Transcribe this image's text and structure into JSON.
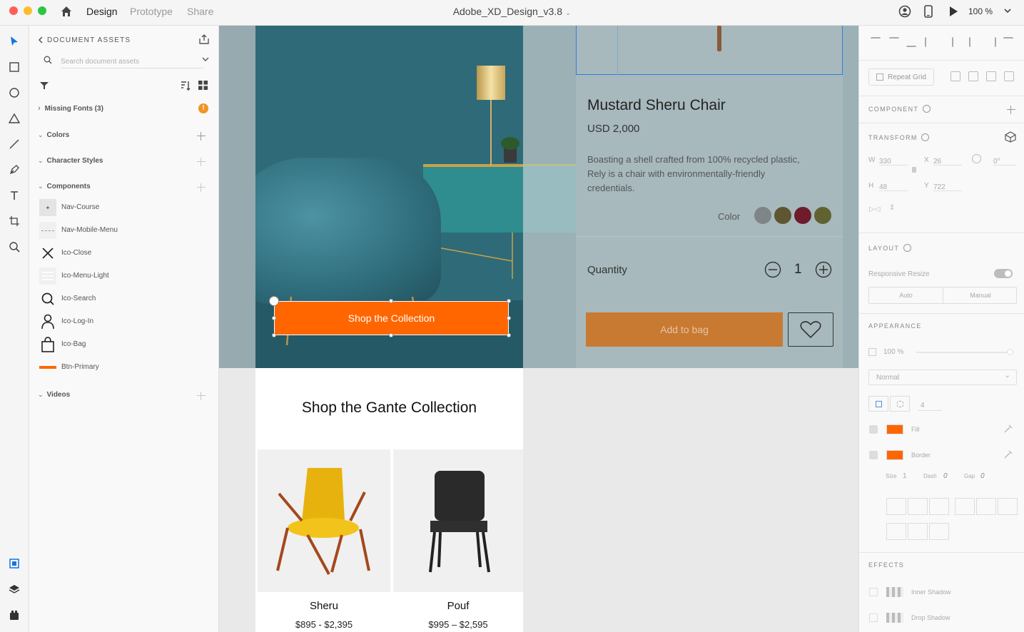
{
  "titlebar": {
    "tabs": [
      "Design",
      "Prototype",
      "Share"
    ],
    "doc_title": "Adobe_XD_Design_v3.8",
    "zoom": "100 %"
  },
  "assets": {
    "header": "DOCUMENT ASSETS",
    "search_placeholder": "Search document assets",
    "missing_fonts": "Missing Fonts (3)",
    "sections": {
      "colors": "Colors",
      "character_styles": "Character Styles",
      "components": "Components",
      "videos": "Videos"
    },
    "components": [
      "Nav-Course",
      "Nav-Mobile-Menu",
      "Ico-Close",
      "Ico-Search",
      "Ico-Log-In",
      "Ico-Bag",
      "Btn-Primary"
    ]
  },
  "canvas": {
    "hero_button": "Shop the Collection",
    "product_title": "Mustard Sheru Chair",
    "product_price": "USD 2,000",
    "product_desc_1": "Boasting a shell crafted from 100% recycled plastic,",
    "product_desc_2": "Rely is a chair with environmentally-friendly",
    "product_desc_3": "credentials.",
    "color_label": "Color",
    "color_swatches": [
      "#7d8587",
      "#5e5532",
      "#6e1c2c",
      "#606231"
    ],
    "quantity_label": "Quantity",
    "quantity_value": "1",
    "add_to_bag": "Add to bag",
    "collection_heading": "Shop the Gante Collection",
    "items": [
      {
        "name": "Sheru",
        "price": "$895 - $2,395"
      },
      {
        "name": "Pouf",
        "price": "$995 – $2,595"
      }
    ]
  },
  "properties": {
    "repeat_grid": "Repeat Grid",
    "component": "COMPONENT",
    "transform": "TRANSFORM",
    "w_label": "W",
    "w_value": "330",
    "x_label": "X",
    "x_value": "26",
    "rotation": "0°",
    "h_label": "H",
    "h_value": "48",
    "y_label": "Y",
    "y_value": "722",
    "layout": "LAYOUT",
    "responsive_resize": "Responsive Resize",
    "auto": "Auto",
    "manual": "Manual",
    "appearance": "APPEARANCE",
    "opacity": "100 %",
    "blend_mode": "Normal",
    "corner_radius": "4",
    "fill": "Fill",
    "border": "Border",
    "size_label": "Size",
    "size_value": "1",
    "dash_label": "Dash",
    "dash_value": "0",
    "gap_label": "Gap",
    "gap_value": "0",
    "effects": "EFFECTS",
    "inner_shadow": "Inner Shadow",
    "drop_shadow": "Drop Shadow",
    "accent_color": "#ff6600"
  }
}
